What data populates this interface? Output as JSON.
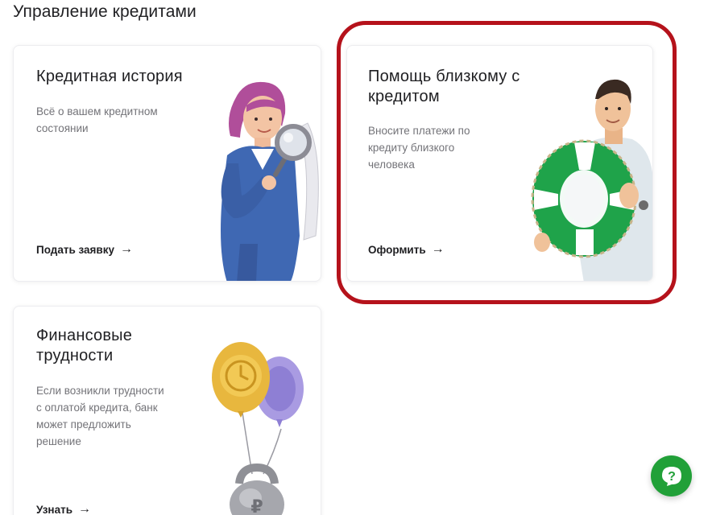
{
  "section": {
    "title": "Управление кредитами"
  },
  "cards": [
    {
      "title_lines": [
        "Кредитная история"
      ],
      "desc_lines": [
        "Всё о вашем кредитном",
        "состоянии"
      ],
      "link": "Подать заявку",
      "illustration": "woman-with-magnifier"
    },
    {
      "title_lines": [
        "Помощь близкому с",
        "кредитом"
      ],
      "desc_lines": [
        "Вносите платежи по",
        "кредиту близкого",
        "человека"
      ],
      "link": "Оформить",
      "illustration": "man-with-lifebuoy",
      "highlighted": true
    },
    {
      "title_lines": [
        "Финансовые",
        "трудности"
      ],
      "desc_lines": [
        "Если возникли трудности",
        "с оплатой кредита, банк",
        "может предложить",
        "решение"
      ],
      "link": "Узнать",
      "illustration": "balloons-with-kettlebell"
    }
  ],
  "help_button": {
    "label": "?",
    "icon": "question-icon"
  },
  "colors": {
    "highlight": "#b5121b",
    "accent_green": "#21a038",
    "text": "#1f1f22",
    "muted": "#737378"
  }
}
